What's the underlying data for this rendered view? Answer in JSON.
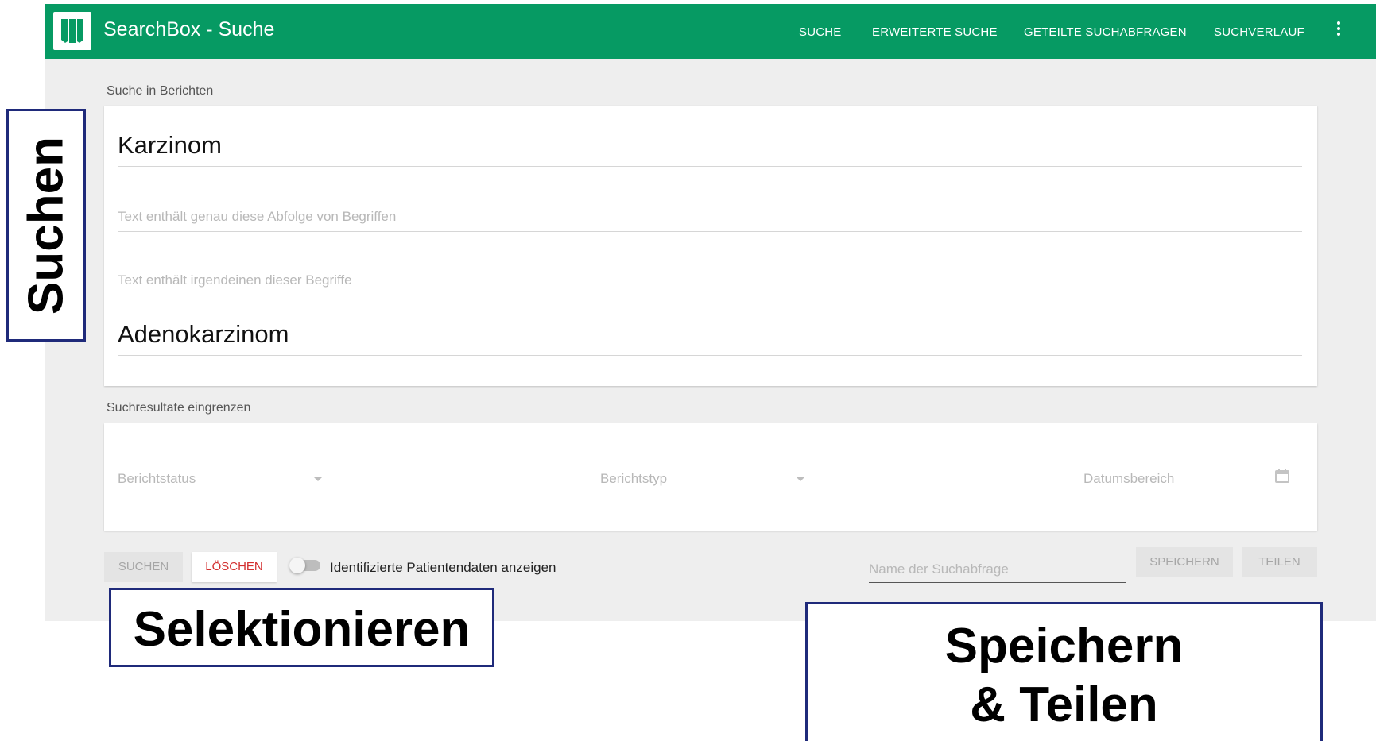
{
  "app": {
    "title": "SearchBox - Suche",
    "brand_color": "#069a63"
  },
  "nav": {
    "items": [
      {
        "label": "SUCHE",
        "active": true
      },
      {
        "label": "ERWEITERTE SUCHE",
        "active": false
      },
      {
        "label": "GETEILTE SUCHABFRAGEN",
        "active": false
      },
      {
        "label": "SUCHVERLAUF",
        "active": false
      }
    ],
    "more_icon": "more-vert-icon"
  },
  "search": {
    "section_label": "Suche in Berichten",
    "term_value": "Karzinom",
    "exact_phrase_placeholder": "Text enthält genau diese Abfolge von Begriffen",
    "any_terms_placeholder": "Text enthält irgendeinen dieser Begriffe",
    "any_terms_value": "Adenokarzinom"
  },
  "filters": {
    "section_label": "Suchresultate eingrenzen",
    "status_placeholder": "Berichtstatus",
    "type_placeholder": "Berichtstyp",
    "date_placeholder": "Datumsbereich",
    "date_icon": "calendar-icon"
  },
  "actions": {
    "search_label": "SUCHEN",
    "delete_label": "LÖSCHEN",
    "toggle_label": "Identifizierte Patientendaten anzeigen",
    "toggle_on": false,
    "query_name_placeholder": "Name der Suchabfrage",
    "save_label": "SPEICHERN",
    "share_label": "TEILEN"
  },
  "callouts": {
    "search": "Suchen",
    "select": "Selektionieren",
    "save_share_line1": "Speichern",
    "save_share_line2": "& Teilen",
    "border_color": "#1f2a7a"
  }
}
